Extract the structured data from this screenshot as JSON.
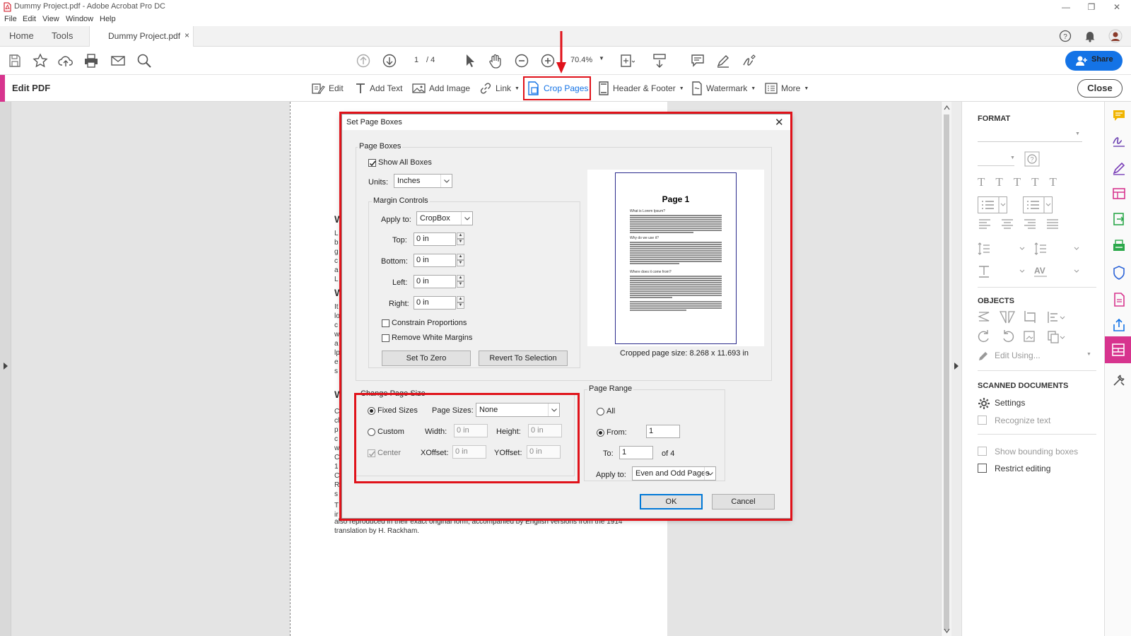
{
  "window": {
    "title": "Dummy Project.pdf - Adobe Acrobat Pro DC"
  },
  "menu": [
    "File",
    "Edit",
    "View",
    "Window",
    "Help"
  ],
  "tabs": {
    "home": "Home",
    "tools": "Tools",
    "document": "Dummy Project.pdf",
    "close": "×"
  },
  "toolbar": {
    "page_current": "1",
    "page_total": "/ 4",
    "zoom": "70.4%",
    "share": "Share"
  },
  "edit_bar": {
    "title": "Edit PDF",
    "tools": [
      "Edit",
      "Add Text",
      "Add Image",
      "Link",
      "Crop Pages",
      "Header & Footer",
      "Watermark",
      "More"
    ],
    "close": "Close"
  },
  "document_fragments": {
    "line1": "also reproduced in their exact original form, accompanied by English versions from the 1914",
    "line2": "translation by H. Rackham."
  },
  "dialog": {
    "title": "Set Page Boxes",
    "page_boxes_label": "Page Boxes",
    "show_all_boxes": "Show All Boxes",
    "units_label": "Units:",
    "units_value": "Inches",
    "margin_controls_label": "Margin Controls",
    "apply_to_label": "Apply to:",
    "apply_to_value": "CropBox",
    "top_label": "Top:",
    "top_value": "0 in",
    "bottom_label": "Bottom:",
    "bottom_value": "0 in",
    "left_label": "Left:",
    "left_value": "0 in",
    "right_label": "Right:",
    "right_value": "0 in",
    "constrain": "Constrain Proportions",
    "remove_white": "Remove White Margins",
    "set_to_zero": "Set To Zero",
    "revert": "Revert To Selection",
    "preview_page_title": "Page 1",
    "preview_h1": "What is Lorem Ipsum?",
    "preview_h2": "Why do we use it?",
    "preview_h3": "Where does it come from?",
    "cropped_size": "Cropped page size: 8.268 x 11.693 in",
    "change_page_size_label": "Change Page Size",
    "fixed_sizes": "Fixed Sizes",
    "page_sizes_label": "Page Sizes:",
    "page_sizes_value": "None",
    "custom": "Custom",
    "width_label": "Width:",
    "width_value": "0 in",
    "height_label": "Height:",
    "height_value": "0 in",
    "center": "Center",
    "xoffset_label": "XOffset:",
    "xoffset_value": "0 in",
    "yoffset_label": "YOffset:",
    "yoffset_value": "0 in",
    "page_range_label": "Page Range",
    "all": "All",
    "from_label": "From:",
    "from_value": "1",
    "to_label": "To:",
    "to_value": "1",
    "of_total": "of 4",
    "range_apply_label": "Apply to:",
    "range_apply_value": "Even and Odd Pages",
    "ok": "OK",
    "cancel": "Cancel"
  },
  "format_panel": {
    "format_header": "FORMAT",
    "objects_header": "OBJECTS",
    "edit_using": "Edit Using...",
    "scanned_header": "SCANNED DOCUMENTS",
    "settings": "Settings",
    "recognize_text": "Recognize text",
    "show_bounding": "Show bounding boxes",
    "restrict_editing": "Restrict editing"
  },
  "colors": {
    "accent": "#d7348e",
    "highlight_red": "#e0121a",
    "share_blue": "#1473e6"
  }
}
